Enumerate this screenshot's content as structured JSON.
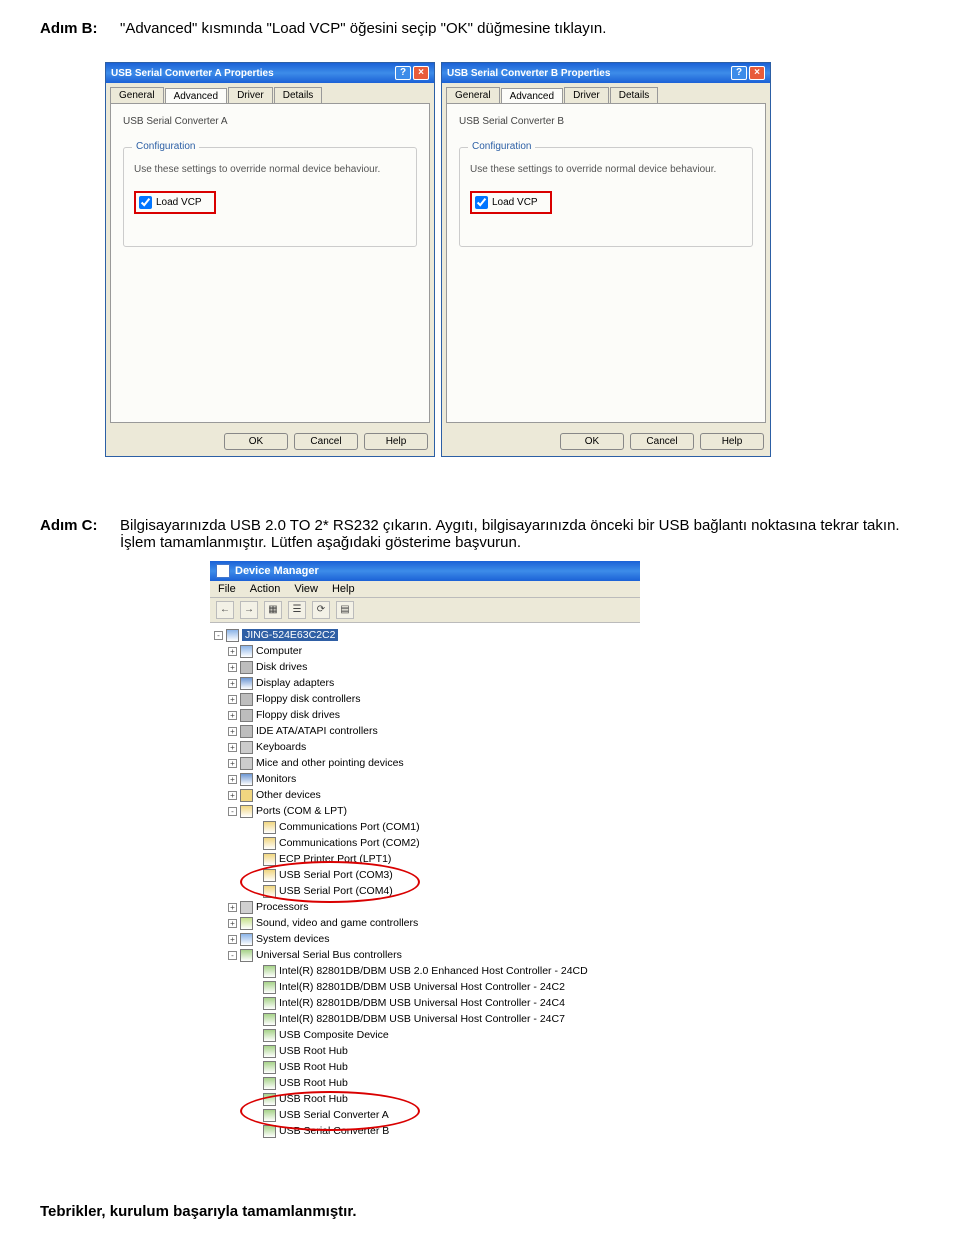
{
  "stepB": {
    "label": "Adım B:",
    "text": "\"Advanced\" kısmında \"Load VCP\" öğesini seçip \"OK\" düğmesine tıklayın."
  },
  "stepC": {
    "label": "Adım C:",
    "text": "Bilgisayarınızda USB 2.0 TO 2* RS232 çıkarın. Aygıtı, bilgisayarınızda önceki bir USB bağlantı noktasına tekrar takın. İşlem tamamlanmıştır. Lütfen aşağıdaki gösterime başvurun."
  },
  "dlg": [
    {
      "title": "USB Serial Converter A Properties",
      "device": "USB Serial Converter A"
    },
    {
      "title": "USB Serial Converter B Properties",
      "device": "USB Serial Converter B"
    }
  ],
  "tabs": {
    "general": "General",
    "advanced": "Advanced",
    "driver": "Driver",
    "details": "Details"
  },
  "fieldset": {
    "legend": "Configuration",
    "desc": "Use these settings to override normal device behaviour.",
    "loadvcp": "Load VCP"
  },
  "buttons": {
    "ok": "OK",
    "cancel": "Cancel",
    "help": "Help"
  },
  "dm": {
    "title": "Device Manager",
    "menu": {
      "file": "File",
      "action": "Action",
      "view": "View",
      "help": "Help"
    },
    "root": "JING-524E63C2C2",
    "nodes": {
      "computer": "Computer",
      "disk": "Disk drives",
      "display": "Display adapters",
      "fdc": "Floppy disk controllers",
      "fdd": "Floppy disk drives",
      "ide": "IDE ATA/ATAPI controllers",
      "keyb": "Keyboards",
      "mice": "Mice and other pointing devices",
      "mon": "Monitors",
      "other": "Other devices",
      "ports": "Ports (COM & LPT)",
      "com1": "Communications Port (COM1)",
      "com2": "Communications Port (COM2)",
      "lpt1": "ECP Printer Port (LPT1)",
      "usp3": "USB Serial Port (COM3)",
      "usp4": "USB Serial Port (COM4)",
      "proc": "Processors",
      "sound": "Sound, video and game controllers",
      "sys": "System devices",
      "usb": "Universal Serial Bus controllers",
      "u1": "Intel(R) 82801DB/DBM USB 2.0 Enhanced Host Controller - 24CD",
      "u2": "Intel(R) 82801DB/DBM USB Universal Host Controller - 24C2",
      "u3": "Intel(R) 82801DB/DBM USB Universal Host Controller - 24C4",
      "u4": "Intel(R) 82801DB/DBM USB Universal Host Controller - 24C7",
      "u5": "USB Composite Device",
      "u6": "USB Root Hub",
      "u7": "USB Root Hub",
      "u8": "USB Root Hub",
      "u9": "USB Root Hub",
      "u10": "USB Serial Converter A",
      "u11": "USB Serial Converter B"
    }
  },
  "congrats": "Tebrikler, kurulum başarıyla tamamlanmıştır."
}
